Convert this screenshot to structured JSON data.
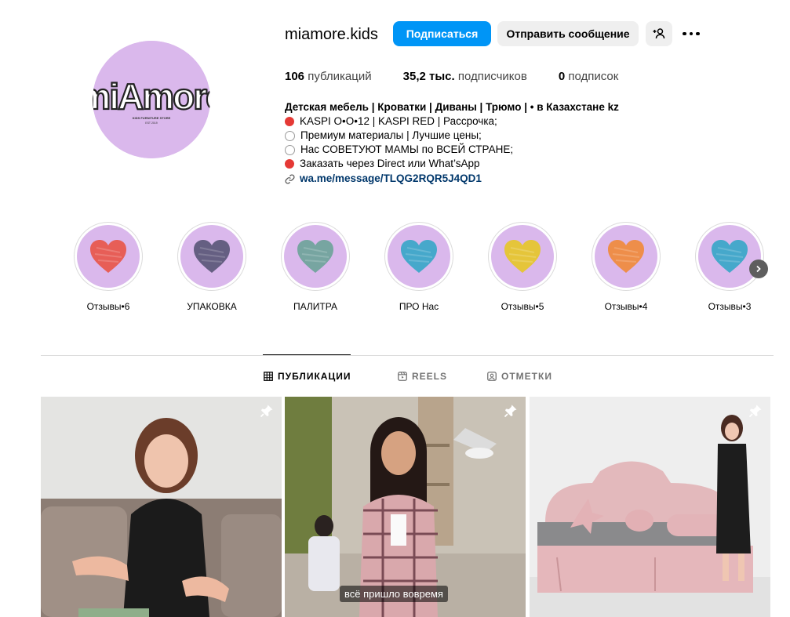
{
  "profile": {
    "username": "miamore.kids",
    "follow_label": "Подписаться",
    "message_label": "Отправить сообщение",
    "stats": {
      "posts_count": "106",
      "posts_label": "публикаций",
      "followers_count": "35,2 тыс.",
      "followers_label": "подписчиков",
      "following_count": "0",
      "following_label": "подписок"
    },
    "avatar_text": "miAmore",
    "bio": {
      "name": "Детская мебель | Кроватки | Диваны | Трюмо | • в Казахстане kz",
      "lines": [
        {
          "dot": "red",
          "text": "KASPI O•O•12 | KASPI RED | Рассрочка;"
        },
        {
          "dot": "white",
          "text": "Премиум материалы | Лучшие цены;"
        },
        {
          "dot": "white",
          "text": "Нас СОВЕТУЮТ МАМЫ по ВСЕЙ СТРАНЕ;"
        },
        {
          "dot": "red",
          "text": "Заказать через Direct или What’sApp"
        }
      ],
      "link": "wa.me/message/TLQG2RQR5J4QD1"
    }
  },
  "highlights": [
    {
      "label": "Отзывы•6",
      "heart_color": "#e8564a"
    },
    {
      "label": "УПАКОВКА",
      "heart_color": "#5b5778"
    },
    {
      "label": "ПАЛИТРА",
      "heart_color": "#6fa39a"
    },
    {
      "label": "ПРО Нас",
      "heart_color": "#3aa6c8"
    },
    {
      "label": "Отзывы•5",
      "heart_color": "#e6c52a"
    },
    {
      "label": "Отзывы•4",
      "heart_color": "#f08a3c"
    },
    {
      "label": "Отзывы•3",
      "heart_color": "#3aa6c8"
    }
  ],
  "tabs": [
    {
      "label": "ПУБЛИКАЦИИ",
      "icon": "grid-icon",
      "active": true
    },
    {
      "label": "REELS",
      "icon": "reels-icon",
      "active": false
    },
    {
      "label": "ОТМЕТКИ",
      "icon": "tagged-icon",
      "active": false
    }
  ],
  "posts": [
    {
      "pinned": true,
      "caption": ""
    },
    {
      "pinned": true,
      "caption": "всё пришло вовремя"
    },
    {
      "pinned": true,
      "caption": ""
    }
  ],
  "colors": {
    "accent": "#0095f6",
    "avatar_bg": "#dab8ec",
    "link": "#00376b"
  }
}
